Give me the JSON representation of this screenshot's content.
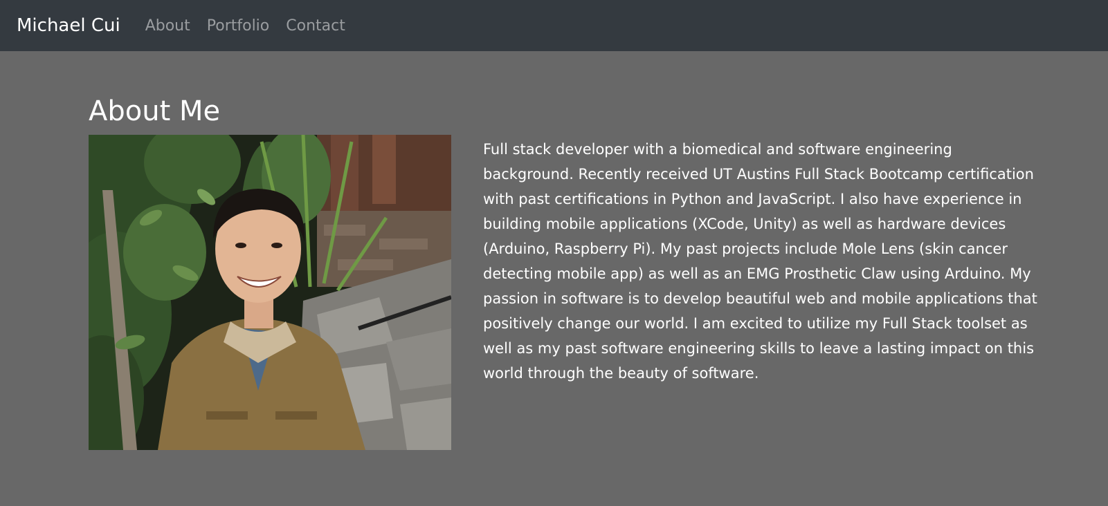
{
  "navbar": {
    "brand": "Michael Cui",
    "links": [
      {
        "label": "About"
      },
      {
        "label": "Portfolio"
      },
      {
        "label": "Contact"
      }
    ],
    "background_color": "#343a40",
    "link_color": "#9a9da0"
  },
  "about": {
    "title": "About Me",
    "bio": "Full stack developer with a biomedical and software engineering background. Recently received UT Austins Full Stack Bootcamp certification with past certifications in Python and JavaScript. I also have experience in building mobile applications (XCode, Unity) as well as hardware devices (Arduino, Raspberry Pi). My past projects include Mole Lens (skin cancer detecting mobile app) as well as an EMG Prosthetic Claw using Arduino. My passion in software is to develop beautiful web and mobile applications that positively change our world. I am excited to utilize my Full Stack toolset as well as my past software engineering skills to leave a lasting impact on this world through the beauty of software.",
    "background_color": "#686868"
  }
}
